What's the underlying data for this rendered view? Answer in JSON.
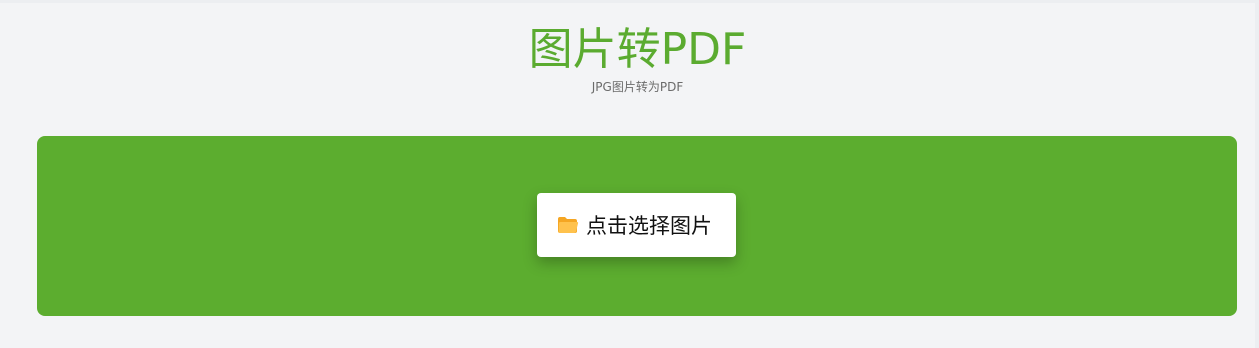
{
  "header": {
    "title": "图片转PDF",
    "subtitle": "JPG图片转为PDF"
  },
  "upload": {
    "button_label": "点击选择图片",
    "button_icon": "folder-icon"
  },
  "colors": {
    "accent": "#5bab30",
    "panel": "#5cad2f",
    "folder": "#f5a623",
    "folder_light": "#ffc24d"
  }
}
